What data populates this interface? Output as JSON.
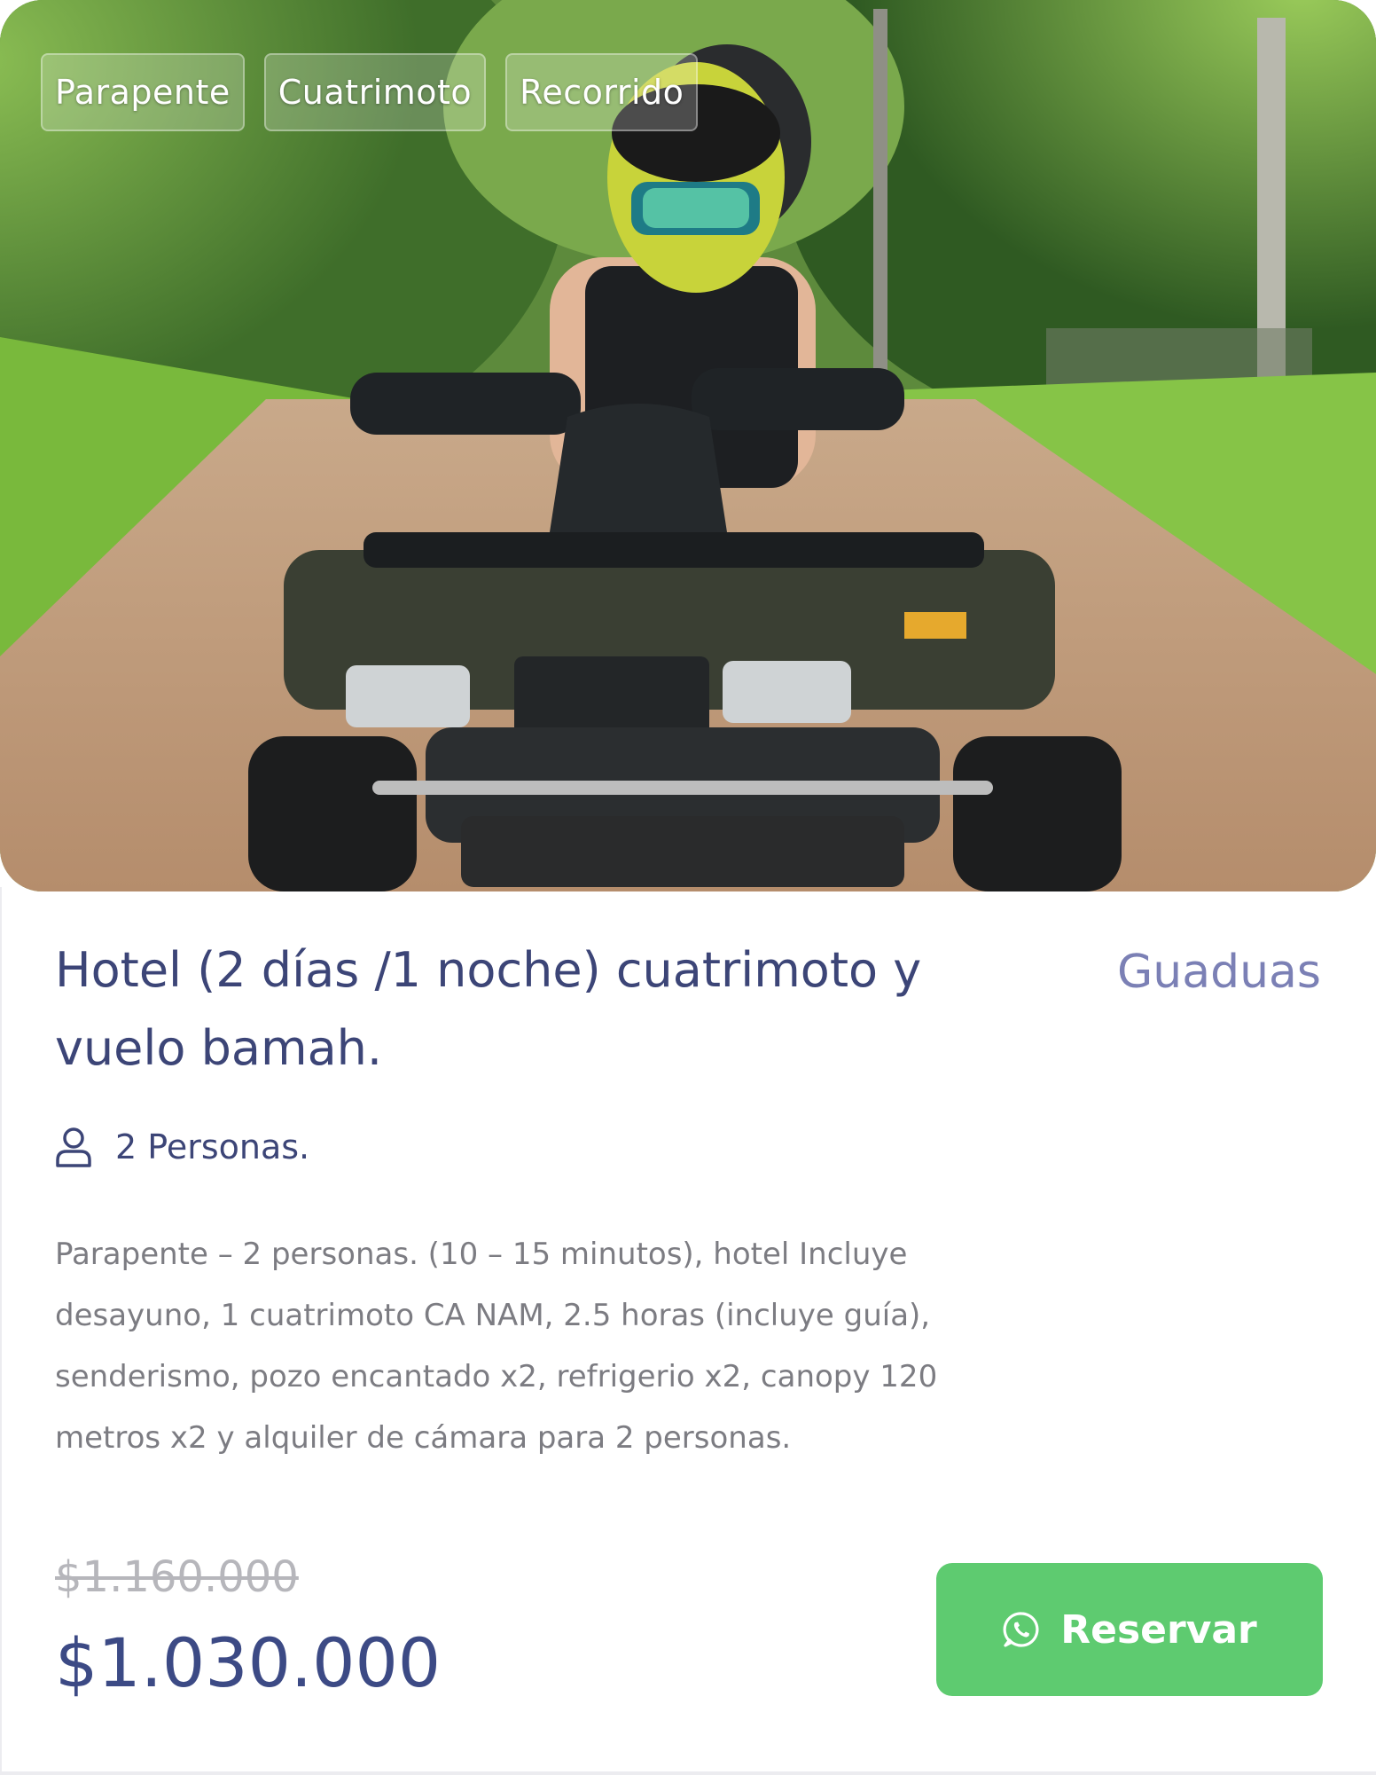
{
  "card": {
    "tags": [
      "Parapente",
      "Cuatrimoto",
      "Recorrido"
    ],
    "title": "Hotel (2 días /1 noche) cuatrimoto y vuelo bamah.",
    "location": "Guaduas",
    "persons": "2 Personas.",
    "description": "Parapente – 2 personas. (10 – 15 minutos), hotel Incluye desayuno, 1 cuatrimoto CA NAM, 2.5 horas (incluye guía), senderismo, pozo encantado x2, refrigerio x2, canopy 120 metros x2 y alquiler de cámara para 2 personas.",
    "old_price": "$1.160.000",
    "price": "$1.030.000",
    "reserve_label": "Reservar",
    "icons": {
      "persons": "user-icon",
      "reserve": "whatsapp-icon"
    },
    "colors": {
      "title": "#3c4577",
      "location": "#7b80b5",
      "price": "#3c4a85",
      "button": "#5ecb70"
    }
  }
}
